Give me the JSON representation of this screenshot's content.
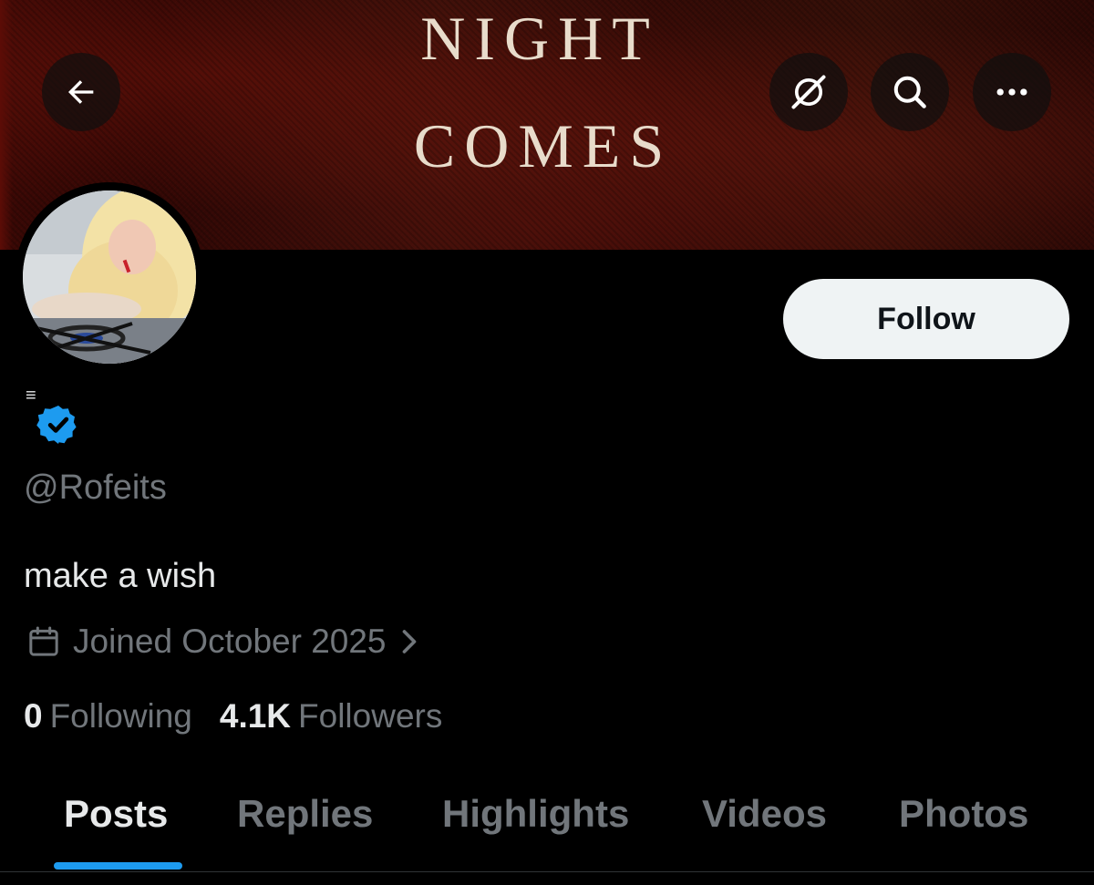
{
  "banner": {
    "line1": "NIGHT",
    "line2": "COMES"
  },
  "nav": {
    "back_icon": "arrow-left-icon",
    "grok_icon": "grok-icon",
    "search_icon": "search-icon",
    "more_icon": "more-horizontal-icon"
  },
  "profile": {
    "display_name": "≡",
    "verified": true,
    "handle": "@Rofeits",
    "bio": "make a wish",
    "joined": "Joined October 2025",
    "following_count": "0",
    "following_label": "Following",
    "followers_count": "4.1K",
    "followers_label": "Followers"
  },
  "actions": {
    "follow_label": "Follow"
  },
  "tabs": [
    {
      "label": "Posts",
      "active": true
    },
    {
      "label": "Replies",
      "active": false
    },
    {
      "label": "Highlights",
      "active": false
    },
    {
      "label": "Videos",
      "active": false
    },
    {
      "label": "Photos",
      "active": false
    }
  ],
  "colors": {
    "background": "#000000",
    "text_primary": "#e7e9ea",
    "text_secondary": "#71767b",
    "accent": "#1d9bf0",
    "verified": "#1d9bf0",
    "follow_bg": "#eff3f4"
  }
}
